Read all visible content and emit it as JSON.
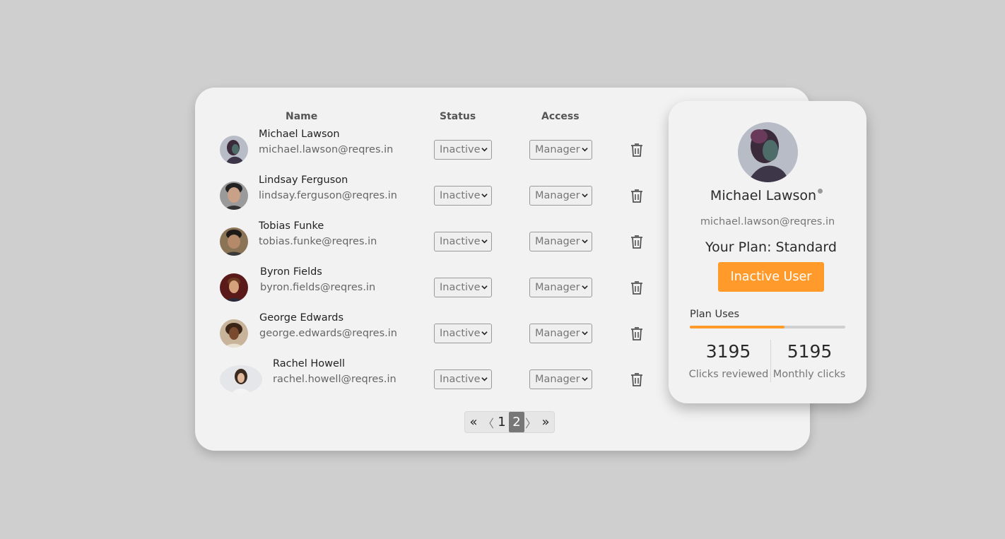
{
  "table": {
    "headers": {
      "name": "Name",
      "status": "Status",
      "access": "Access"
    },
    "rows": [
      {
        "name": "Michael Lawson",
        "email": "michael.lawson@reqres.in",
        "status": "Inactive",
        "access": "Manager"
      },
      {
        "name": "Lindsay Ferguson",
        "email": "lindsay.ferguson@reqres.in",
        "status": "Inactive",
        "access": "Manager"
      },
      {
        "name": "Tobias Funke",
        "email": "tobias.funke@reqres.in",
        "status": "Inactive",
        "access": "Manager"
      },
      {
        "name": "Byron Fields",
        "email": "byron.fields@reqres.in",
        "status": "Inactive",
        "access": "Manager"
      },
      {
        "name": "George Edwards",
        "email": "george.edwards@reqres.in",
        "status": "Inactive",
        "access": "Manager"
      },
      {
        "name": "Rachel Howell",
        "email": "rachel.howell@reqres.in",
        "status": "Inactive",
        "access": "Manager"
      }
    ]
  },
  "pagination": {
    "first": "«",
    "prev": "〈",
    "pages": [
      "1",
      "2"
    ],
    "current": "2",
    "next": "〉",
    "last": "»"
  },
  "profile": {
    "name": "Michael Lawson",
    "email": "michael.lawson@reqres.in",
    "plan": "Your Plan: Standard",
    "status_button": "Inactive User",
    "plan_uses_label": "Plan Uses",
    "plan_uses_fraction": 0.61,
    "clicks_reviewed": "3195",
    "clicks_reviewed_label": "Clicks reviewed",
    "monthly_clicks": "5195",
    "monthly_clicks_label": "Monthly clicks"
  },
  "colors": {
    "accent": "#ff9a2b",
    "background": "#cfcfcf",
    "card": "#f2f2f2"
  },
  "icons": {
    "delete": "trash-icon",
    "dropdown": "chevron-down-icon"
  }
}
